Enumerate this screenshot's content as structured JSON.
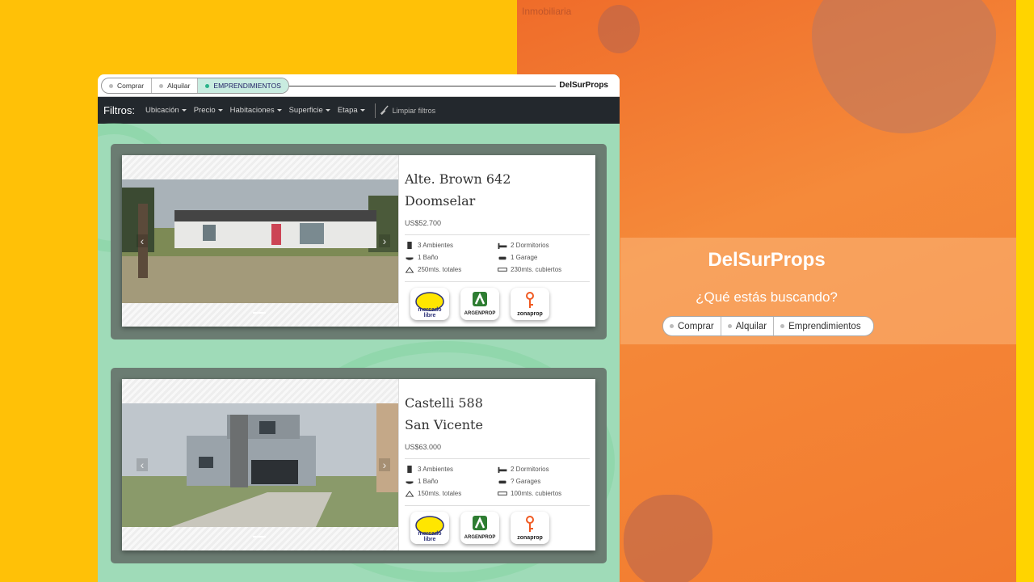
{
  "right": {
    "label": "Inmobiliaria",
    "hero_title": "DelSurProps",
    "hero_question": "¿Qué estás buscando?",
    "hero_tabs": [
      "Comprar",
      "Alquilar",
      "Emprendimientos"
    ]
  },
  "window": {
    "tabs": [
      "Comprar",
      "Alquilar",
      "EMPRENDIMIENTOS"
    ],
    "active_tab": "EMPRENDIMIENTOS",
    "brand": "DelSurProps",
    "filters_label": "Filtros:",
    "filters": [
      "Ubicación",
      "Precio",
      "Habitaciones",
      "Superficie",
      "Etapa"
    ],
    "clear_filters": "Limpiar filtros"
  },
  "listings": [
    {
      "street": "Alte. Brown 642",
      "city": "Doomselar",
      "price": "US$52.700",
      "features": [
        "3 Ambientes",
        "2 Dormitorios",
        "1 Baño",
        "1 Garage",
        "250mts. totales",
        "230mts. cubiertos"
      ],
      "logos": [
        "mercado libre",
        "ARGENPROP",
        "zonaprop"
      ]
    },
    {
      "street": "Castelli 588",
      "city": "San Vicente",
      "price": "US$63.000",
      "features": [
        "3 Ambientes",
        "2 Dormitorios",
        "1 Baño",
        "? Garages",
        "150mts. totales",
        "100mts. cubiertos"
      ],
      "logos": [
        "mercado libre",
        "ARGENPROP",
        "zonaprop"
      ]
    }
  ],
  "colors": {
    "left_bg": "#ffc107",
    "right_bg": "#ef6c2a",
    "content_bg": "#9fdbb8",
    "filter_bar": "#23282d",
    "card_frame": "#6b7c72"
  }
}
